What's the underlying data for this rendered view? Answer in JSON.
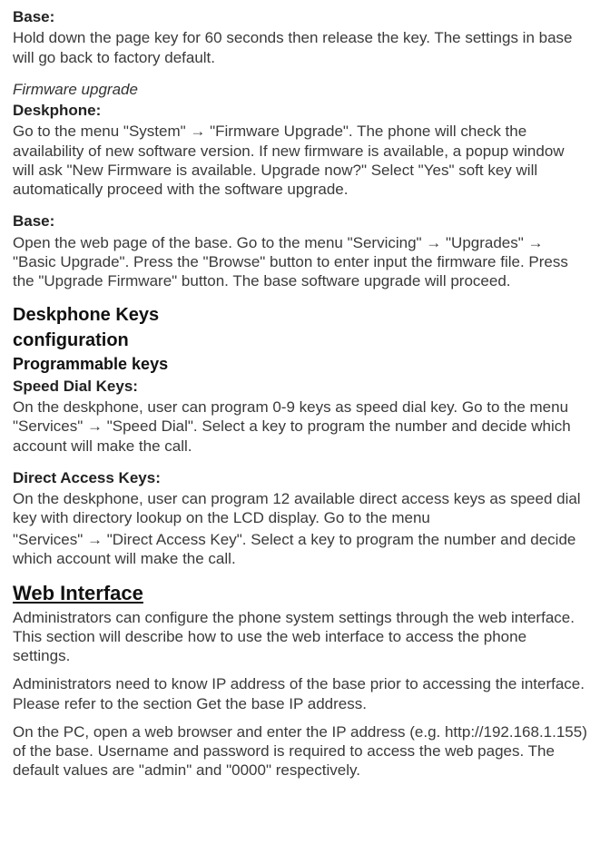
{
  "s1": {
    "heading": "Base:",
    "body": "Hold down the page key for 60 seconds then release the key. The settings in base will go back to factory default."
  },
  "s2": {
    "heading": "Firmware upgrade",
    "sub": "Deskphone:",
    "body": "Go to the menu \"System\" → \"Firmware Upgrade\". The phone will check the availability of new software version. If new firmware is available, a popup window will ask \"New Firmware is available. Upgrade now?\" Select \"Yes\" soft key will automatically proceed with the software upgrade."
  },
  "s3": {
    "heading": "Base:",
    "body": "Open the web page of the base. Go to the menu \"Servicing\" → \"Upgrades\" → \"Basic Upgrade\". Press the \"Browse\" button to enter input the firmware file. Press the \"Upgrade Firmware\" button. The base software upgrade will proceed."
  },
  "s4": {
    "h1a": "Deskphone Keys",
    "h1b": "configuration",
    "h2": "Programmable keys",
    "sdHeading": "Speed Dial Keys:",
    "sdBody": "On the deskphone, user can program 0-9 keys as speed dial key. Go to the menu \"Services\" → \"Speed Dial\". Select a key to program the number and decide which account will make the call."
  },
  "s5": {
    "heading": "Direct Access Keys:",
    "body1": "On the deskphone, user can program 12 available direct access keys as speed dial key with directory lookup on the LCD display. Go to the menu",
    "body2": "\"Services\" → \"Direct Access Key\". Select a key to program the number and decide which account will make the call."
  },
  "s6": {
    "heading": "Web Interface",
    "p1": "Administrators can configure the phone system settings through the web interface. This section will describe how to use the web interface to access the phone settings.",
    "p2": "Administrators need to know IP address of the base prior to accessing the interface. Please refer to the section Get the base IP address.",
    "p3": "On the PC, open a web browser and enter the IP address (e.g. http://192.168.1.155) of the base. Username and password is required to access the web pages. The default values are \"admin\" and \"0000\" respectively."
  }
}
